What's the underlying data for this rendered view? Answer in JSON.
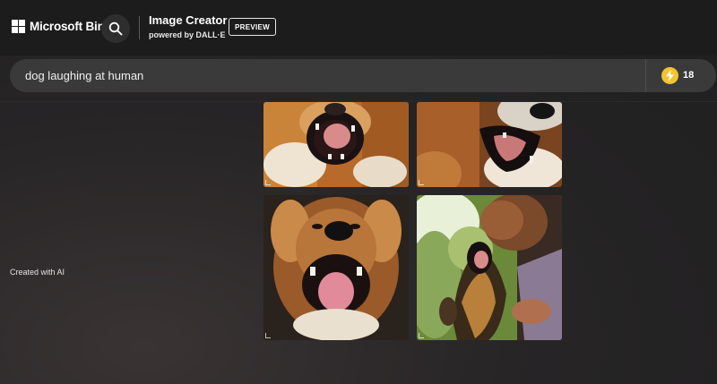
{
  "header": {
    "logo_text": "Microsoft Bing",
    "app_title": "Image Creator",
    "app_subtitle": "powered by DALL·E",
    "preview_badge": "PREVIEW"
  },
  "search": {
    "query": "dog laughing at human",
    "boost_count": "18"
  },
  "results": {
    "images": [
      {
        "name": "result-image-1",
        "icon": "dog-laughing-closeup"
      },
      {
        "name": "result-image-2",
        "icon": "dog-laughing-side"
      },
      {
        "name": "result-image-3",
        "icon": "dog-laughing-front"
      },
      {
        "name": "result-image-4",
        "icon": "dog-and-human"
      }
    ]
  },
  "sidebar": {
    "caption": "Created with AI"
  },
  "colors": {
    "topbar": "#1c1c1c",
    "searchbar": "#3a3a3a",
    "coin": "#f4c430"
  }
}
